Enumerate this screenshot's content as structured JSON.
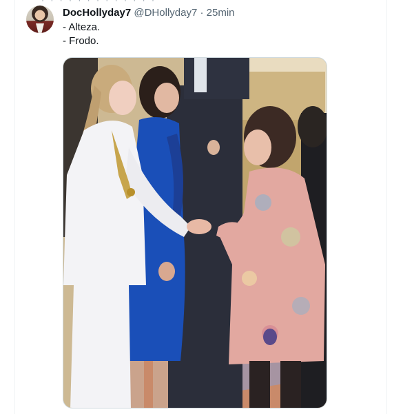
{
  "tweet": {
    "display_name": "DocHollyday7",
    "handle": "@DHollyday7",
    "separator": "·",
    "time": "25min",
    "text_lines": [
      "- Alteza.",
      "- Frodo."
    ]
  },
  "icons": {
    "avatar": "user-avatar-photo"
  },
  "colors": {
    "text_primary": "#0f1419",
    "text_secondary": "#536471",
    "border": "#cfd9de"
  }
}
